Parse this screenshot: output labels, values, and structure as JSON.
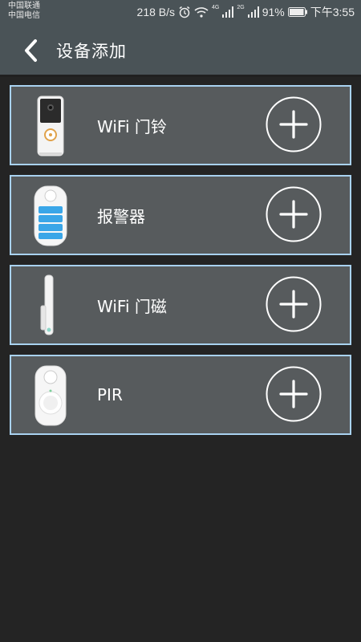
{
  "status_bar": {
    "carrier1": "中国联通",
    "carrier2": "中国电信",
    "speed": "218 B/s",
    "net1": "4G",
    "net2": "2G",
    "battery": "91%",
    "time": "下午3:55"
  },
  "header": {
    "title": "设备添加"
  },
  "devices": [
    {
      "name": "WiFi 门铃",
      "icon": "doorbell-icon"
    },
    {
      "name": "报警器",
      "icon": "alarm-icon"
    },
    {
      "name": "WiFi 门磁",
      "icon": "door-sensor-icon"
    },
    {
      "name": "PIR",
      "icon": "pir-sensor-icon"
    }
  ],
  "colors": {
    "background": "#242424",
    "bar": "#4a5357",
    "card": "#575b5d",
    "card_border": "#a9d2f0"
  }
}
